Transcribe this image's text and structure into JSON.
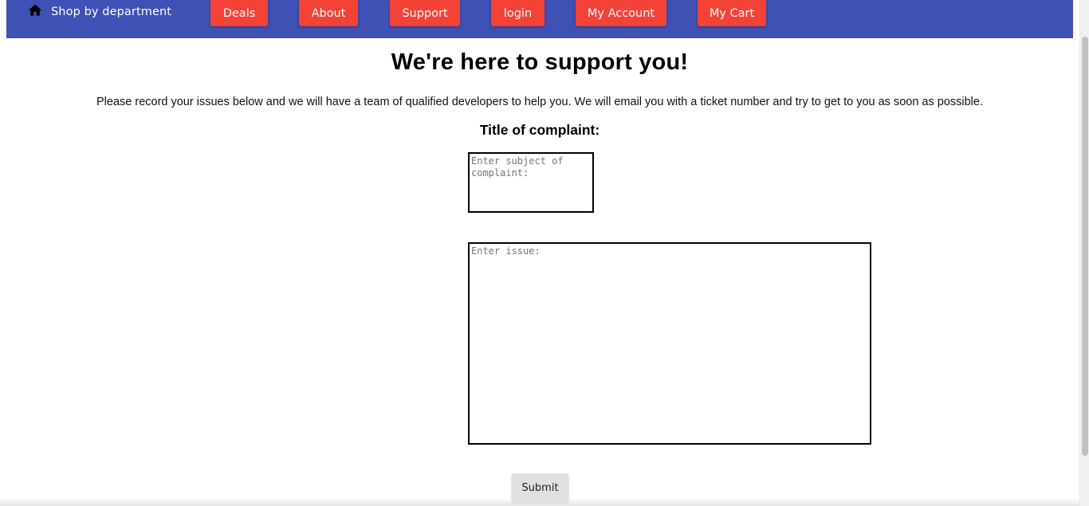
{
  "nav": {
    "shop_label": "Shop by department",
    "buttons": [
      {
        "label": "Deals"
      },
      {
        "label": "About"
      },
      {
        "label": "Support"
      },
      {
        "label": "login"
      },
      {
        "label": "My Account"
      },
      {
        "label": "My Cart"
      }
    ],
    "icon": "home-icon"
  },
  "main": {
    "heading": "We're here to support you!",
    "intro": "Please record your issues below and we will have a team of qualified developers to help you. We will email you with a ticket number and try to get to you as soon as possible.",
    "title_label": "Title of complaint:",
    "subject": {
      "placeholder": "Enter subject of complaint:",
      "value": ""
    },
    "issue": {
      "placeholder": "Enter issue:",
      "value": ""
    },
    "submit_label": "Submit"
  },
  "colors": {
    "navbar": "#3f51b5",
    "nav_button": "#f44336",
    "submit_button": "#e0e0e0"
  }
}
